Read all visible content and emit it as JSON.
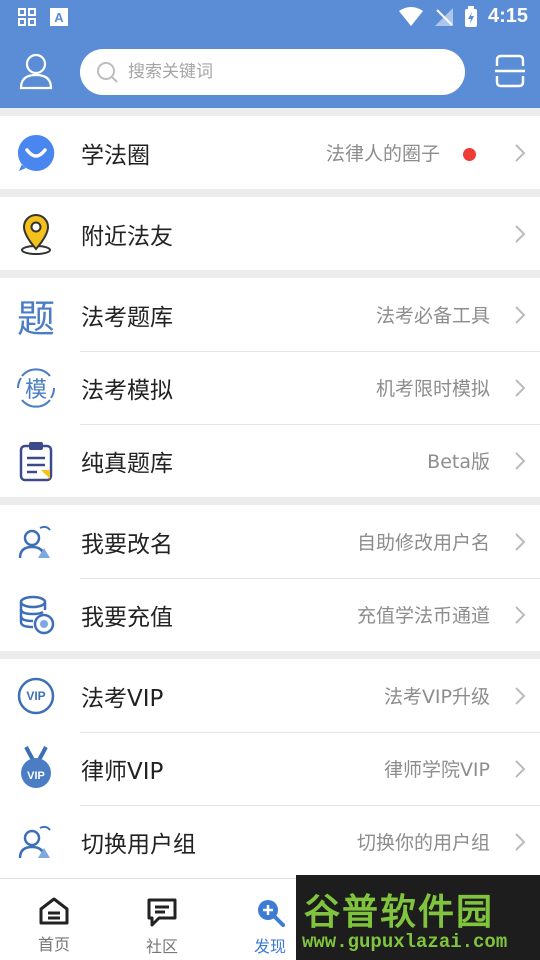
{
  "status_bar": {
    "time": "4:15"
  },
  "header": {
    "search_placeholder": "搜索关键词"
  },
  "groups": [
    {
      "items": [
        {
          "title": "学法圈",
          "subtitle": "法律人的圈子",
          "has_dot": true,
          "icon": "chat-bubble-icon"
        }
      ]
    },
    {
      "items": [
        {
          "title": "附近法友",
          "subtitle": "",
          "icon": "location-pin-icon"
        }
      ]
    },
    {
      "items": [
        {
          "title": "法考题库",
          "subtitle": "法考必备工具",
          "icon": "question-bank-icon",
          "icon_text": "题"
        },
        {
          "title": "法考模拟",
          "subtitle": "机考限时模拟",
          "icon": "mock-exam-icon",
          "icon_text": "模"
        },
        {
          "title": "纯真题库",
          "subtitle": "Beta版",
          "icon": "clipboard-icon"
        }
      ]
    },
    {
      "items": [
        {
          "title": "我要改名",
          "subtitle": "自助修改用户名",
          "icon": "user-rename-icon"
        },
        {
          "title": "我要充值",
          "subtitle": "充值学法币通道",
          "icon": "coin-stack-icon"
        }
      ]
    },
    {
      "items": [
        {
          "title": "法考VIP",
          "subtitle": "法考VIP升级",
          "icon": "vip-badge-icon",
          "icon_text": "VIP"
        },
        {
          "title": "律师VIP",
          "subtitle": "律师学院VIP",
          "icon": "vip-medal-icon",
          "icon_text": "VIP"
        },
        {
          "title": "切换用户组",
          "subtitle": "切换你的用户组",
          "icon": "switch-group-icon"
        }
      ]
    }
  ],
  "tabs": [
    {
      "label": "首页",
      "icon": "home-icon"
    },
    {
      "label": "社区",
      "icon": "message-icon"
    },
    {
      "label": "发现",
      "icon": "discover-search-icon",
      "active": true
    }
  ],
  "watermark": {
    "title": "谷普软件园",
    "url": "www.gupuxlazai.com"
  },
  "colors": {
    "header": "#5b8dd6",
    "accent": "#3d7bd4",
    "dot": "#f03a3a"
  }
}
